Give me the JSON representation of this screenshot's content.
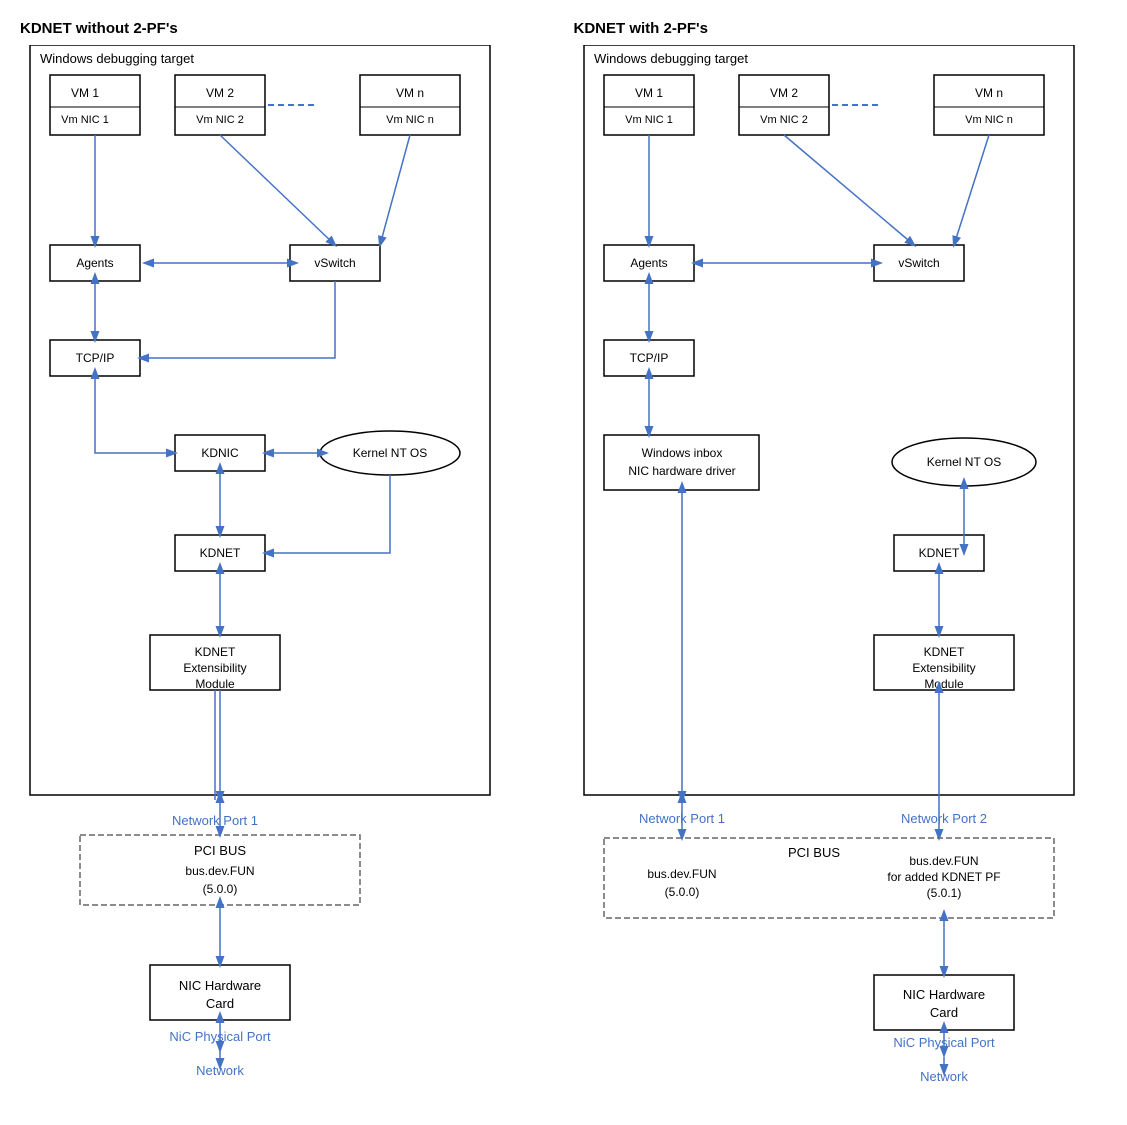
{
  "diagrams": [
    {
      "title": "KDNET without 2-PF's",
      "debug_label": "Windows debugging target",
      "vms": [
        {
          "vm": "VM 1",
          "nic": "Vm NIC 1"
        },
        {
          "vm": "VM 2",
          "nic": "Vm NIC 2"
        },
        {
          "vm": "VM n",
          "nic": "Vm NIC n"
        }
      ],
      "boxes": {
        "agents": "Agents",
        "vswitch": "vSwitch",
        "tcpip": "TCP/IP",
        "kdnic": "KDNIC",
        "kernel": "Kernel NT OS",
        "kdnet": "KDNET",
        "extensibility": "KDNET\nExtensibility\nModule"
      },
      "pci": {
        "port_label": "Network Port 1",
        "bus_label": "PCI BUS",
        "bus_dev": "bus.dev.FUN\n(5.0.0)"
      },
      "nic_label": "NIC Hardware\nCard",
      "physical_port": "NiC Physical Port",
      "network": "Network"
    },
    {
      "title": "KDNET with 2-PF's",
      "debug_label": "Windows debugging target",
      "vms": [
        {
          "vm": "VM 1",
          "nic": "Vm NIC 1"
        },
        {
          "vm": "VM 2",
          "nic": "Vm NIC 2"
        },
        {
          "vm": "VM n",
          "nic": "Vm NIC n"
        }
      ],
      "boxes": {
        "agents": "Agents",
        "vswitch": "vSwitch",
        "tcpip": "TCP/IP",
        "windows_nic": "Windows inbox\nNIC hardware driver",
        "kernel": "Kernel NT OS",
        "kdnet": "KDNET",
        "extensibility": "KDNET\nExtensibility\nModule"
      },
      "pci": {
        "port1_label": "Network Port 1",
        "port2_label": "Network Port 2",
        "bus_label": "PCI BUS",
        "bus_dev1": "bus.dev.FUN\n(5.0.0)",
        "bus_dev2": "bus.dev.FUN\nfor added KDNET PF\n(5.0.1)"
      },
      "nic_label": "NIC Hardware\nCard",
      "physical_port": "NiC Physical Port",
      "network": "Network"
    }
  ]
}
